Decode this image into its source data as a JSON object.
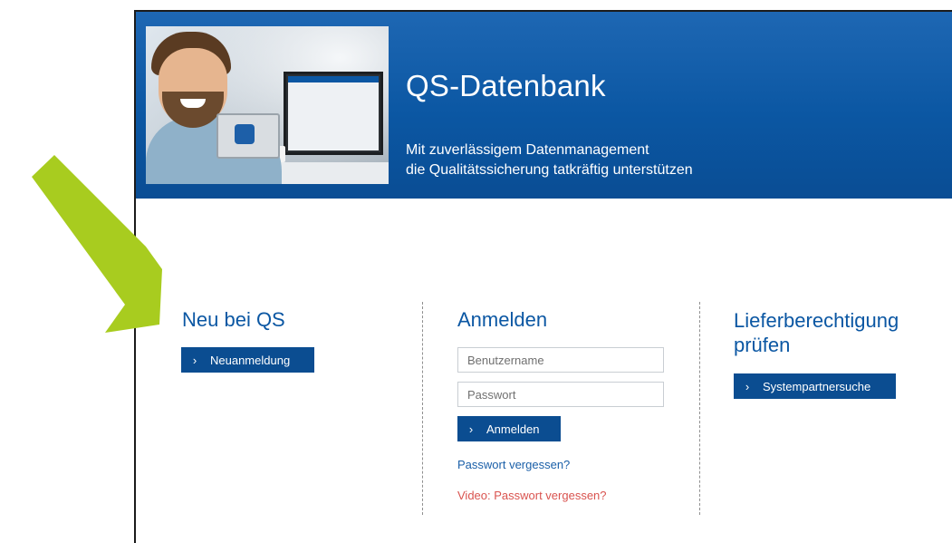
{
  "header": {
    "title": "QS-Datenbank",
    "subtitle_line1": "Mit zuverlässigem Datenmanagement",
    "subtitle_line2": "die Qualitätssicherung tatkräftig unterstützen"
  },
  "new_user": {
    "heading": "Neu bei QS",
    "button_label": "Neuanmeldung"
  },
  "login": {
    "heading": "Anmelden",
    "username_placeholder": "Benutzername",
    "username_value": "",
    "password_placeholder": "Passwort",
    "password_value": "",
    "button_label": "Anmelden",
    "forgot_link": "Passwort vergessen?",
    "video_link": "Video: Passwort vergessen?"
  },
  "delivery": {
    "heading_line1": "Lieferberechtigung",
    "heading_line2": "prüfen",
    "button_label": "Systempartnersuche"
  },
  "colors": {
    "brand_blue": "#0b57a3",
    "button_blue": "#0b4d91",
    "link_blue": "#1a5fa8",
    "link_red": "#d9534f",
    "annotation_arrow": "#a8cc1f"
  },
  "icons": {
    "button_chevron": "chevron-right-icon",
    "annotation": "arrow-annotation-icon"
  }
}
